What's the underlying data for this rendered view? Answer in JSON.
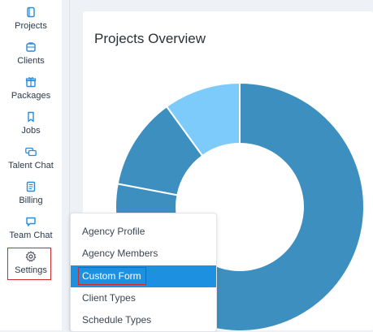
{
  "sidebar": {
    "items": [
      {
        "label": "Projects",
        "icon": "projects-icon"
      },
      {
        "label": "Clients",
        "icon": "clients-icon"
      },
      {
        "label": "Packages",
        "icon": "packages-icon"
      },
      {
        "label": "Jobs",
        "icon": "jobs-icon"
      },
      {
        "label": "Talent Chat",
        "icon": "talent-chat-icon"
      },
      {
        "label": "Billing",
        "icon": "billing-icon"
      },
      {
        "label": "Team Chat",
        "icon": "team-chat-icon"
      },
      {
        "label": "Settings",
        "icon": "gear-icon"
      }
    ],
    "icon_color": "#2a8ad8",
    "highlight_color": "#d02b2b"
  },
  "main": {
    "title": "Projects Overview"
  },
  "chart_data": {
    "type": "pie",
    "title": "Projects Overview",
    "slices": [
      {
        "value": 0.78,
        "color": "#3d8fbf"
      },
      {
        "value": 0.12,
        "color": "#3d8fbf"
      },
      {
        "value": 0.1,
        "color": "#7dcbfb"
      }
    ]
  },
  "settings_menu": {
    "items": [
      {
        "label": "Agency Profile"
      },
      {
        "label": "Agency Members"
      },
      {
        "label": "Custom Form",
        "active": true
      },
      {
        "label": "Client Types"
      },
      {
        "label": "Schedule Types"
      }
    ],
    "active_color": "#1e90e0"
  }
}
